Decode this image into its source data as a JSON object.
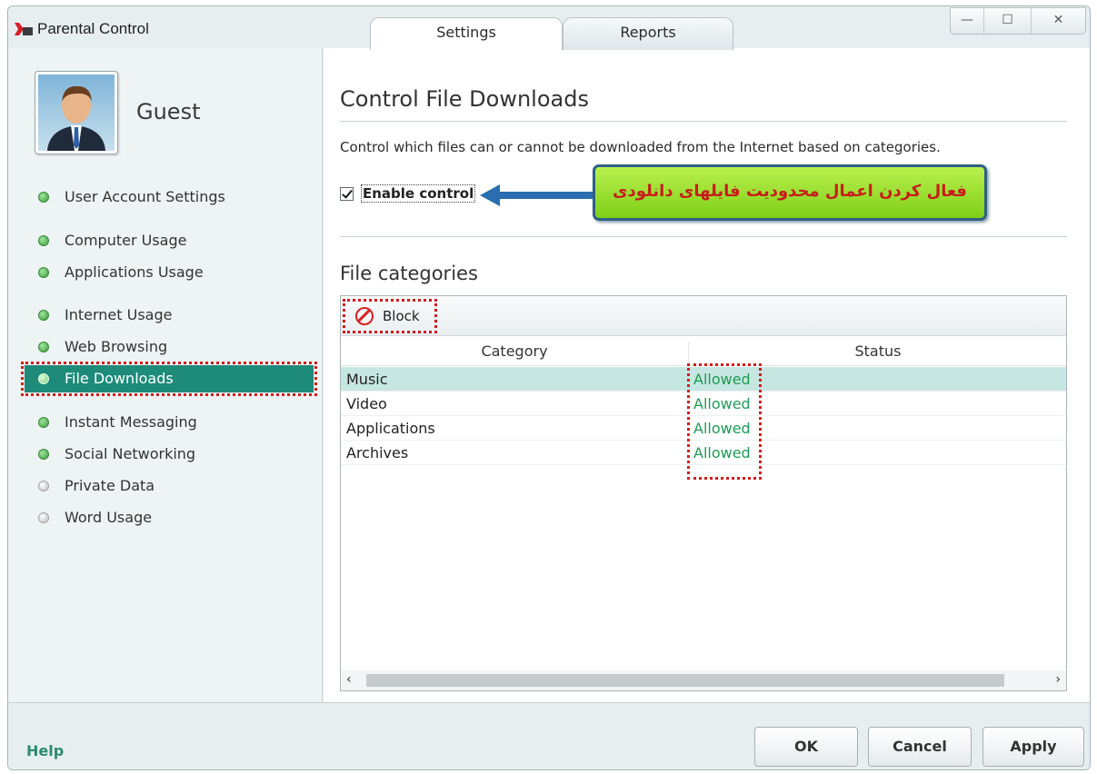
{
  "window": {
    "title": "Parental Control",
    "tabs": [
      {
        "label": "Settings",
        "active": true
      },
      {
        "label": "Reports",
        "active": false
      }
    ],
    "controls": {
      "minimize": "—",
      "maximize": "☐",
      "close": "✕"
    }
  },
  "sidebar": {
    "user": {
      "name": "Guest"
    },
    "items": [
      {
        "label": "User Account Settings",
        "status": "green"
      },
      {
        "label": "Computer Usage",
        "status": "green"
      },
      {
        "label": "Applications Usage",
        "status": "green"
      },
      {
        "label": "Internet Usage",
        "status": "green"
      },
      {
        "label": "Web Browsing",
        "status": "green"
      },
      {
        "label": "File Downloads",
        "status": "green",
        "active": true
      },
      {
        "label": "Instant Messaging",
        "status": "green"
      },
      {
        "label": "Social Networking",
        "status": "green"
      },
      {
        "label": "Private Data",
        "status": "gray"
      },
      {
        "label": "Word Usage",
        "status": "gray"
      }
    ]
  },
  "main": {
    "title": "Control File Downloads",
    "description": "Control which files can or cannot be downloaded from the Internet based on categories.",
    "enable_control": {
      "label": "Enable control",
      "checked": true
    },
    "annotation": "فعال کردن اعمال محدودیت فایلهای دانلودی",
    "section_title": "File categories",
    "toolbar": {
      "block_label": "Block"
    },
    "table": {
      "columns": [
        "Category",
        "Status"
      ],
      "rows": [
        {
          "category": "Music",
          "status": "Allowed",
          "selected": true
        },
        {
          "category": "Video",
          "status": "Allowed"
        },
        {
          "category": "Applications",
          "status": "Allowed"
        },
        {
          "category": "Archives",
          "status": "Allowed"
        }
      ]
    },
    "scroll": {
      "left": "‹",
      "right": "›"
    }
  },
  "footer": {
    "help": "Help",
    "ok": "OK",
    "cancel": "Cancel",
    "apply": "Apply"
  },
  "colors": {
    "accent": "#1e8b7a",
    "allowed": "#1d9a55",
    "highlight": "#d11d1d",
    "callout_bg": "#9ade2e"
  }
}
